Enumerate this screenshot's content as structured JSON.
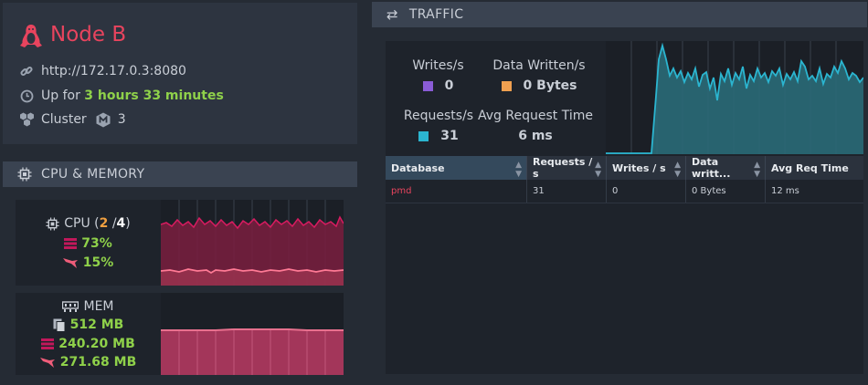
{
  "node": {
    "name": "Node B",
    "url": "http://172.17.0.3:8080",
    "uptime_prefix": "Up for",
    "uptime_value": "3 hours 33 minutes",
    "cluster_label": "Cluster",
    "cluster_count": "3"
  },
  "cpu_memory": {
    "header": "CPU & MEMORY",
    "cpu_label": "CPU",
    "cpu_paren_open": "(",
    "cpu_used": "2",
    "cpu_sep": "/",
    "cpu_total": "4",
    "cpu_paren_close": ")",
    "cpu_machine_pct": "73%",
    "cpu_process_pct": "15%",
    "mem_label": "MEM",
    "mem_total": "512 MB",
    "mem_machine": "240.20 MB",
    "mem_process": "271.68 MB",
    "colors": {
      "machine": "#c2185b",
      "process": "#ef5d7a",
      "mem_fill": "#b03a5b"
    }
  },
  "traffic": {
    "header": "TRAFFIC",
    "writes_label": "Writes/s",
    "writes_value": "0",
    "data_written_label": "Data Written/s",
    "data_written_value": "0 Bytes",
    "requests_label": "Requests/s",
    "requests_value": "31",
    "avg_req_label": "Avg Request Time",
    "avg_req_value": "6 ms",
    "colors": {
      "writes": "#8a5cd6",
      "data_written": "#f0a050",
      "requests": "#2bb5d0"
    },
    "table": {
      "columns": [
        "Database",
        "Requests / s",
        "Writes / s",
        "Data writt...",
        "Avg Req Time"
      ],
      "rows": [
        {
          "database": "pmd",
          "requests": "31",
          "writes": "0",
          "data_written": "0 Bytes",
          "avg_req_time": "12 ms"
        }
      ]
    }
  }
}
